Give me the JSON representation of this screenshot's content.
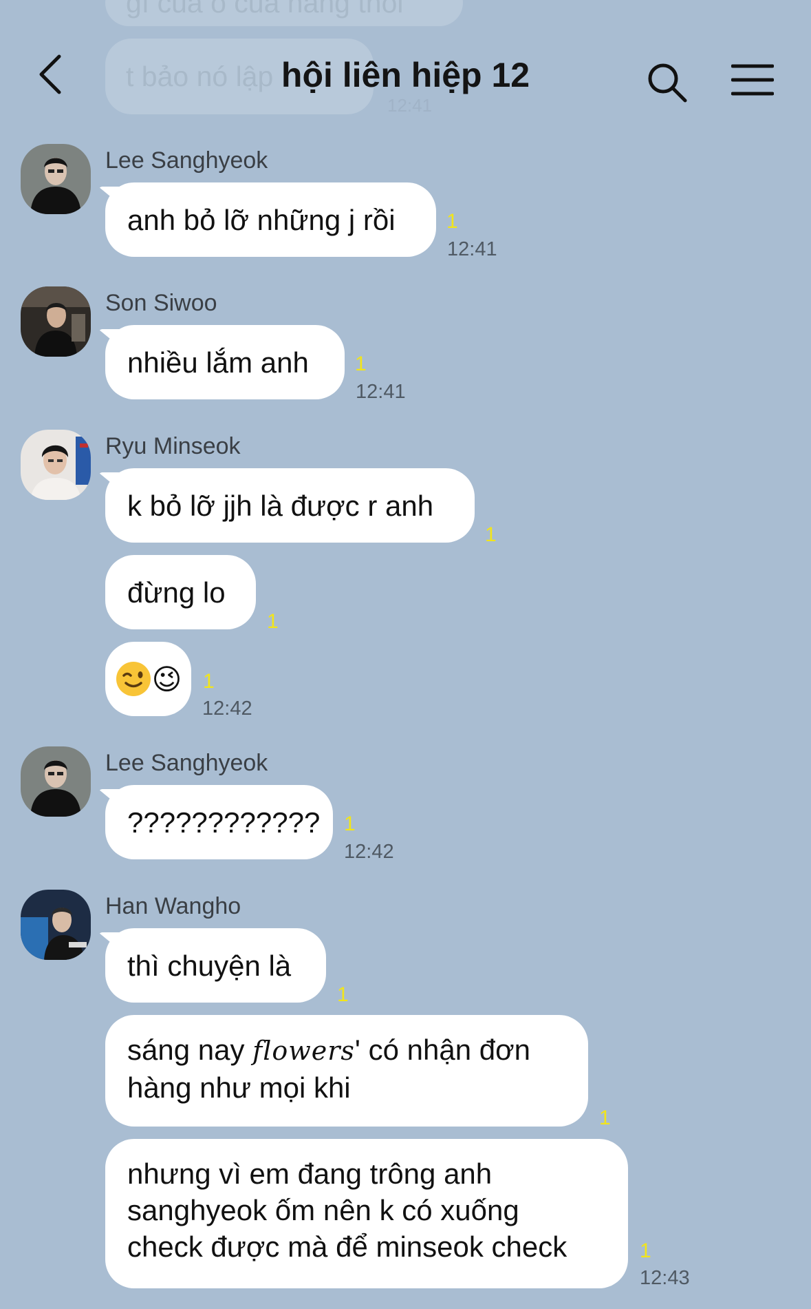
{
  "chat": {
    "title": "hội liên hiệp 12",
    "background": "#a9bdd2",
    "ghost_top_text": "gì của ô của hàng thôi",
    "ghost_msg_text": "t bảo nó lập",
    "ghost_time": "12:41"
  },
  "groups": [
    {
      "sender": "Lee Sanghyeok",
      "messages": [
        {
          "text": "anh bỏ lỡ những j rồi",
          "unread": "1",
          "time": "12:41"
        }
      ]
    },
    {
      "sender": "Son Siwoo",
      "messages": [
        {
          "text": "nhiều lắm anh",
          "unread": "1",
          "time": "12:41"
        }
      ]
    },
    {
      "sender": "Ryu Minseok",
      "messages": [
        {
          "text": "k bỏ lỡ jjh là được r anh",
          "unread": "1"
        },
        {
          "text": "đừng lo",
          "unread": "1"
        },
        {
          "text": "😉",
          "unread": "1",
          "time": "12:42"
        }
      ]
    },
    {
      "sender": "Lee Sanghyeok",
      "messages": [
        {
          "text": "????????????",
          "unread": "1",
          "time": "12:42"
        }
      ]
    },
    {
      "sender": "Han Wangho",
      "messages": [
        {
          "text": "thì chuyện là",
          "unread": "1"
        },
        {
          "text_a": "sáng nay ",
          "text_fancy": "flowers",
          "text_b": "' có nhận đơn",
          "line2": "hàng như mọi khi",
          "unread": "1"
        },
        {
          "line1": "nhưng vì em đang trông anh",
          "line2": "sanghyeok ốm nên k có xuống",
          "line3": "check được mà để minseok check",
          "unread": "1",
          "time": "12:43"
        }
      ]
    }
  ]
}
